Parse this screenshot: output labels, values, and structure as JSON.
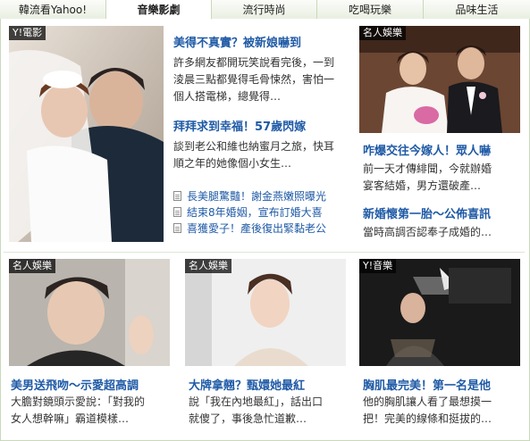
{
  "tabs": [
    {
      "label": "韓流看Yahoo!",
      "active": false
    },
    {
      "label": "音樂影劇",
      "active": true
    },
    {
      "label": "流行時尚",
      "active": false
    },
    {
      "label": "吃喝玩樂",
      "active": false
    },
    {
      "label": "品味生活",
      "active": false
    }
  ],
  "feature": {
    "badge": "Y!電影",
    "story1": {
      "headline": "美得不真實？被新娘嚇到",
      "lines": [
        "許多網友都開玩笑說看完後，一到",
        "淩晨三點都覺得毛骨悚然，害怕一",
        "個人搭電梯，總覺得…"
      ]
    },
    "story2": {
      "headline": "拜拜求到幸福！57歲閃嫁",
      "lines": [
        "談到老公和維也納蜜月之旅，快耳",
        "順之年的她像個小女生…"
      ]
    },
    "links": [
      "長美腿驚豔！謝金燕嫩照曝光",
      "結束8年婚姻，宣布訂婚大喜",
      "喜獲愛子！產後復出緊黏老公"
    ]
  },
  "right_top": {
    "badge": "名人娛樂",
    "headline": "咋爆交往今嫁人！眾人嚇",
    "lines": [
      "前一天才傳緋聞，今就辦婚",
      "宴客結婚，男方還破產…"
    ],
    "headline2": "新婚懷第一胎～公佈喜訊",
    "lines2": [
      "當時高調否認奉子成婚的…"
    ]
  },
  "bottom": [
    {
      "badge": "名人娛樂",
      "headline": "美男送飛吻～示愛超高調",
      "lines": [
        "大膽對鏡頭示愛說：「對我的",
        "女人想幹嘛」霸道模樣…"
      ]
    },
    {
      "badge": "名人娛樂",
      "headline": "大牌拿翹？甄嬛她最紅",
      "lines": [
        "說「我在內地最紅」，話出口",
        "就傻了，事後急忙道歉…"
      ]
    },
    {
      "badge": "Y!音樂",
      "headline": "胸肌最完美！第一名是他",
      "lines": [
        "他的胸肌讓人看了最想摸一",
        "把！完美的線條和挺拔的…"
      ]
    }
  ]
}
